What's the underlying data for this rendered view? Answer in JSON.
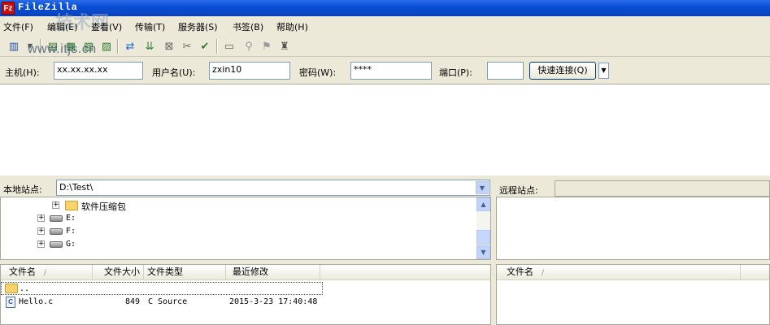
{
  "window": {
    "title": "FileZilla",
    "icon_letters": "Fz"
  },
  "watermark": {
    "text": "www.itjs.cn",
    "logo_text": "技术网"
  },
  "menu": [
    {
      "id": "file",
      "label": "文件(F)"
    },
    {
      "id": "edit",
      "label": "编辑(E)"
    },
    {
      "id": "view",
      "label": "查看(V)"
    },
    {
      "id": "transfer",
      "label": "传输(T)"
    },
    {
      "id": "server",
      "label": "服务器(S)"
    },
    {
      "id": "bookmarks",
      "label": "书签(B)"
    },
    {
      "id": "help",
      "label": "帮助(H)"
    }
  ],
  "quickconnect": {
    "host_label": "主机(H):",
    "host_value": "xx.xx.xx.xx",
    "user_label": "用户名(U):",
    "user_value": "zxin10",
    "password_label": "密码(W):",
    "password_value": "****",
    "port_label": "端口(P):",
    "port_value": "",
    "button_label": "快速连接(Q)"
  },
  "local_site": {
    "label": "本地站点:",
    "path": "D:\\Test\\",
    "tree": [
      {
        "name": "软件压缩包",
        "type": "folder"
      },
      {
        "name": "E:",
        "type": "drive"
      },
      {
        "name": "F:",
        "type": "drive"
      },
      {
        "name": "G:",
        "type": "drive"
      }
    ]
  },
  "remote_site": {
    "label": "远程站点:",
    "path": ""
  },
  "local_list": {
    "columns": [
      "文件名",
      "文件大小",
      "文件类型",
      "最近修改"
    ],
    "sort_indicator": "/",
    "rows": [
      {
        "name": "..",
        "size": "",
        "type": "",
        "modified": ""
      },
      {
        "name": "Hello.c",
        "size": "849",
        "type": "C Source",
        "modified": "2015-3-23 17:40:48"
      }
    ]
  },
  "remote_list": {
    "columns": [
      "文件名"
    ],
    "sort_indicator": "/"
  }
}
